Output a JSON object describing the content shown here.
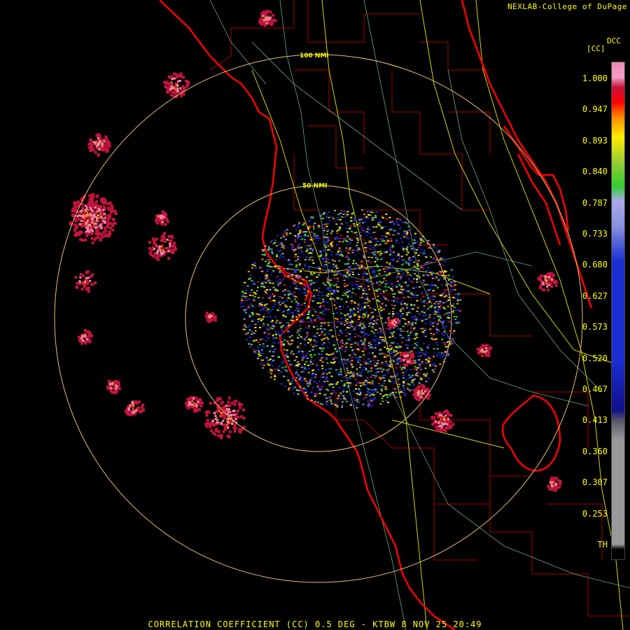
{
  "credit": "NEXLAB-College of DuPage",
  "product_code": "DCC",
  "product_unit": "[CC]",
  "range_rings": [
    "50 NMI",
    "100 NMI"
  ],
  "caption": "CORRELATION COEFFICIENT (CC) 0.5 DEG - KTBW 8 NOV 25 20:49",
  "colorbar": {
    "labels": [
      "1.000",
      "0.947",
      "0.893",
      "0.840",
      "0.787",
      "0.733",
      "0.680",
      "0.627",
      "0.573",
      "0.520",
      "0.467",
      "0.413",
      "0.360",
      "0.307",
      "0.253",
      "TH"
    ],
    "colors": {
      "pink": "#e98ab4",
      "crimson": "#c3143c",
      "red": "#ff0000",
      "orange": "#ff8800",
      "yellow": "#ffee00",
      "green": "#33cc33",
      "periwinkle": "#8890dd",
      "blue": "#1a2fd0",
      "dark_blue": "#10108a",
      "gray": "#999999",
      "black": "#000000"
    }
  },
  "map_colors": {
    "coastline": "#ff0000",
    "county": "#aa0000",
    "highway": "#d6d600",
    "road": "#66aa88",
    "range_ring": "#e8c070"
  }
}
